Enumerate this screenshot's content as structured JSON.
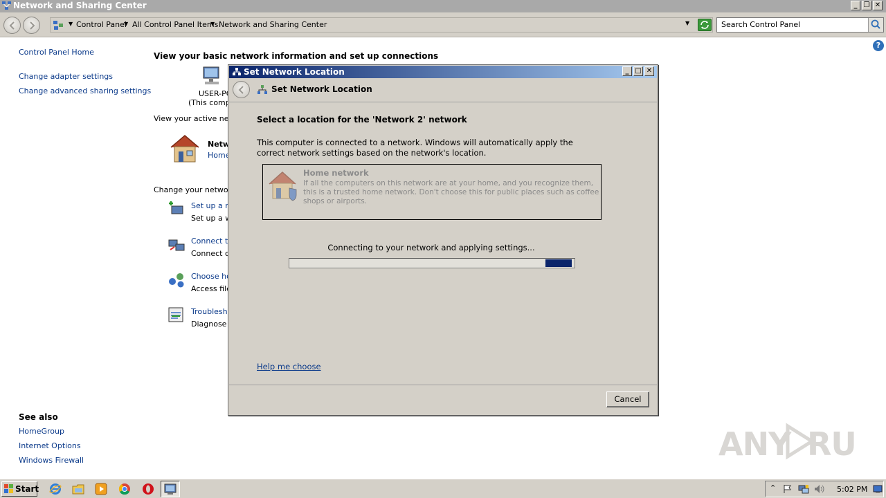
{
  "window": {
    "title": "Network and Sharing Center",
    "icon": "network-sharing-icon"
  },
  "address": {
    "crumbs": [
      "Control Panel",
      "All Control Panel Items",
      "Network and Sharing Center"
    ],
    "search_placeholder": "Search Control Panel"
  },
  "left_pane": {
    "home": "Control Panel Home",
    "links": [
      "Change adapter settings",
      "Change advanced sharing settings"
    ],
    "see_also_title": "See also",
    "see_also": [
      "HomeGroup",
      "Internet Options",
      "Windows Firewall"
    ]
  },
  "main": {
    "heading": "View your basic network information and set up connections",
    "computer_name": "USER-PC",
    "computer_sub": "(This compu",
    "active_label": "View your active netw",
    "network_name": "Netw",
    "network_type": "Home",
    "change_label": "Change your networki",
    "tasks": [
      {
        "title": "Set up a ne",
        "desc": "Set up a wi",
        "icon": "new-connection-icon"
      },
      {
        "title": "Connect to",
        "desc": "Connect or",
        "icon": "connect-network-icon"
      },
      {
        "title": "Choose hor",
        "desc": "Access files",
        "icon": "homegroup-icon"
      },
      {
        "title": "Troublesho",
        "desc": "Diagnose a",
        "icon": "troubleshoot-icon"
      }
    ]
  },
  "dialog": {
    "title": "Set Network Location",
    "header": "Set Network Location",
    "question": "Select a location for the 'Network  2' network",
    "description": "This computer is connected to a network. Windows will automatically apply the correct network settings based on the network's location.",
    "card_title": "Home network",
    "card_desc": "If all the computers on this network are at your home, and you recognize them, this is a trusted home network.  Don't choose this for public places such as coffee shops or airports.",
    "progress_text": "Connecting to your network and applying settings...",
    "progress_indeterminate": true,
    "help_link": "Help me choose",
    "cancel": "Cancel"
  },
  "watermark": "ANY RUN",
  "taskbar": {
    "start": "Start",
    "pinned": [
      "ie-icon",
      "explorer-icon",
      "media-player-icon",
      "chrome-icon",
      "opera-icon",
      "network-center-icon"
    ],
    "clock": "5:02 PM"
  },
  "colors": {
    "title_gradient_start": "#0a246a",
    "title_gradient_end": "#a6caf0",
    "link": "#0b3a8a",
    "face": "#d4d0c8"
  }
}
